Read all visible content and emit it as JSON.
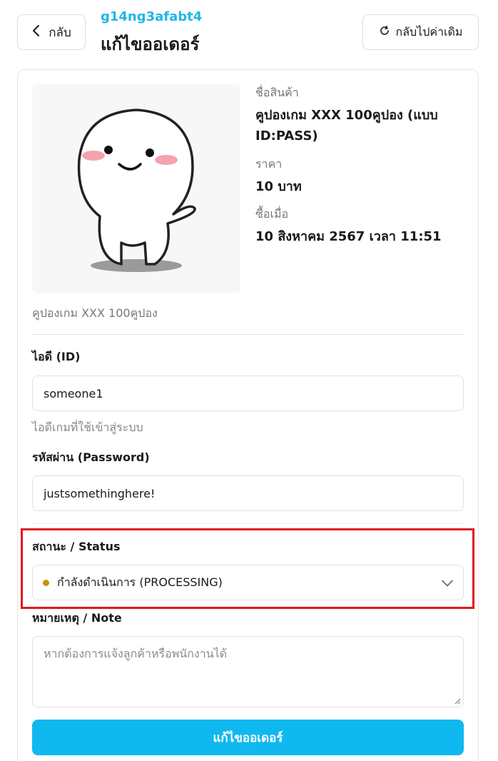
{
  "header": {
    "back_label": "กลับ",
    "order_code": "g14ng3afabt4",
    "title": "แก้ไขออเดอร์",
    "reset_label": "กลับไปค่าเดิม"
  },
  "product": {
    "name_label": "ชื่อสินค้า",
    "name": "คูปองเกม XXX 100คูปอง (แบบ ID:PASS)",
    "price_label": "ราคา",
    "price": "10 บาท",
    "purchased_label": "ซื้อเมื่อ",
    "purchased_at": "10 สิงหาคม 2567 เวลา 11:51",
    "description": "คูปองเกม XXX 100คูปอง"
  },
  "form": {
    "id_label": "ไอดี (ID)",
    "id_value": "someone1",
    "id_hint": "ไอดีเกมที่ใช้เข้าสู่ระบบ",
    "password_label": "รหัสผ่าน (Password)",
    "password_value": "justsomethinghere!",
    "status_label": "สถานะ / Status",
    "status_value": "กำลังดำเนินการ (PROCESSING)",
    "note_label": "หมายเหตุ / Note",
    "note_placeholder": "หากต้องการแจ้งลูกค้าหรือพนักงานได้",
    "submit_label": "แก้ไขออเดอร์"
  },
  "colors": {
    "accent": "#0fb9ef",
    "order_code": "#1fb6e8",
    "status_dot": "#c8920b",
    "highlight": "#e0191e"
  },
  "icons": {
    "back": "chevron-left-icon",
    "reset": "refresh-icon",
    "select": "chevron-down-icon"
  }
}
